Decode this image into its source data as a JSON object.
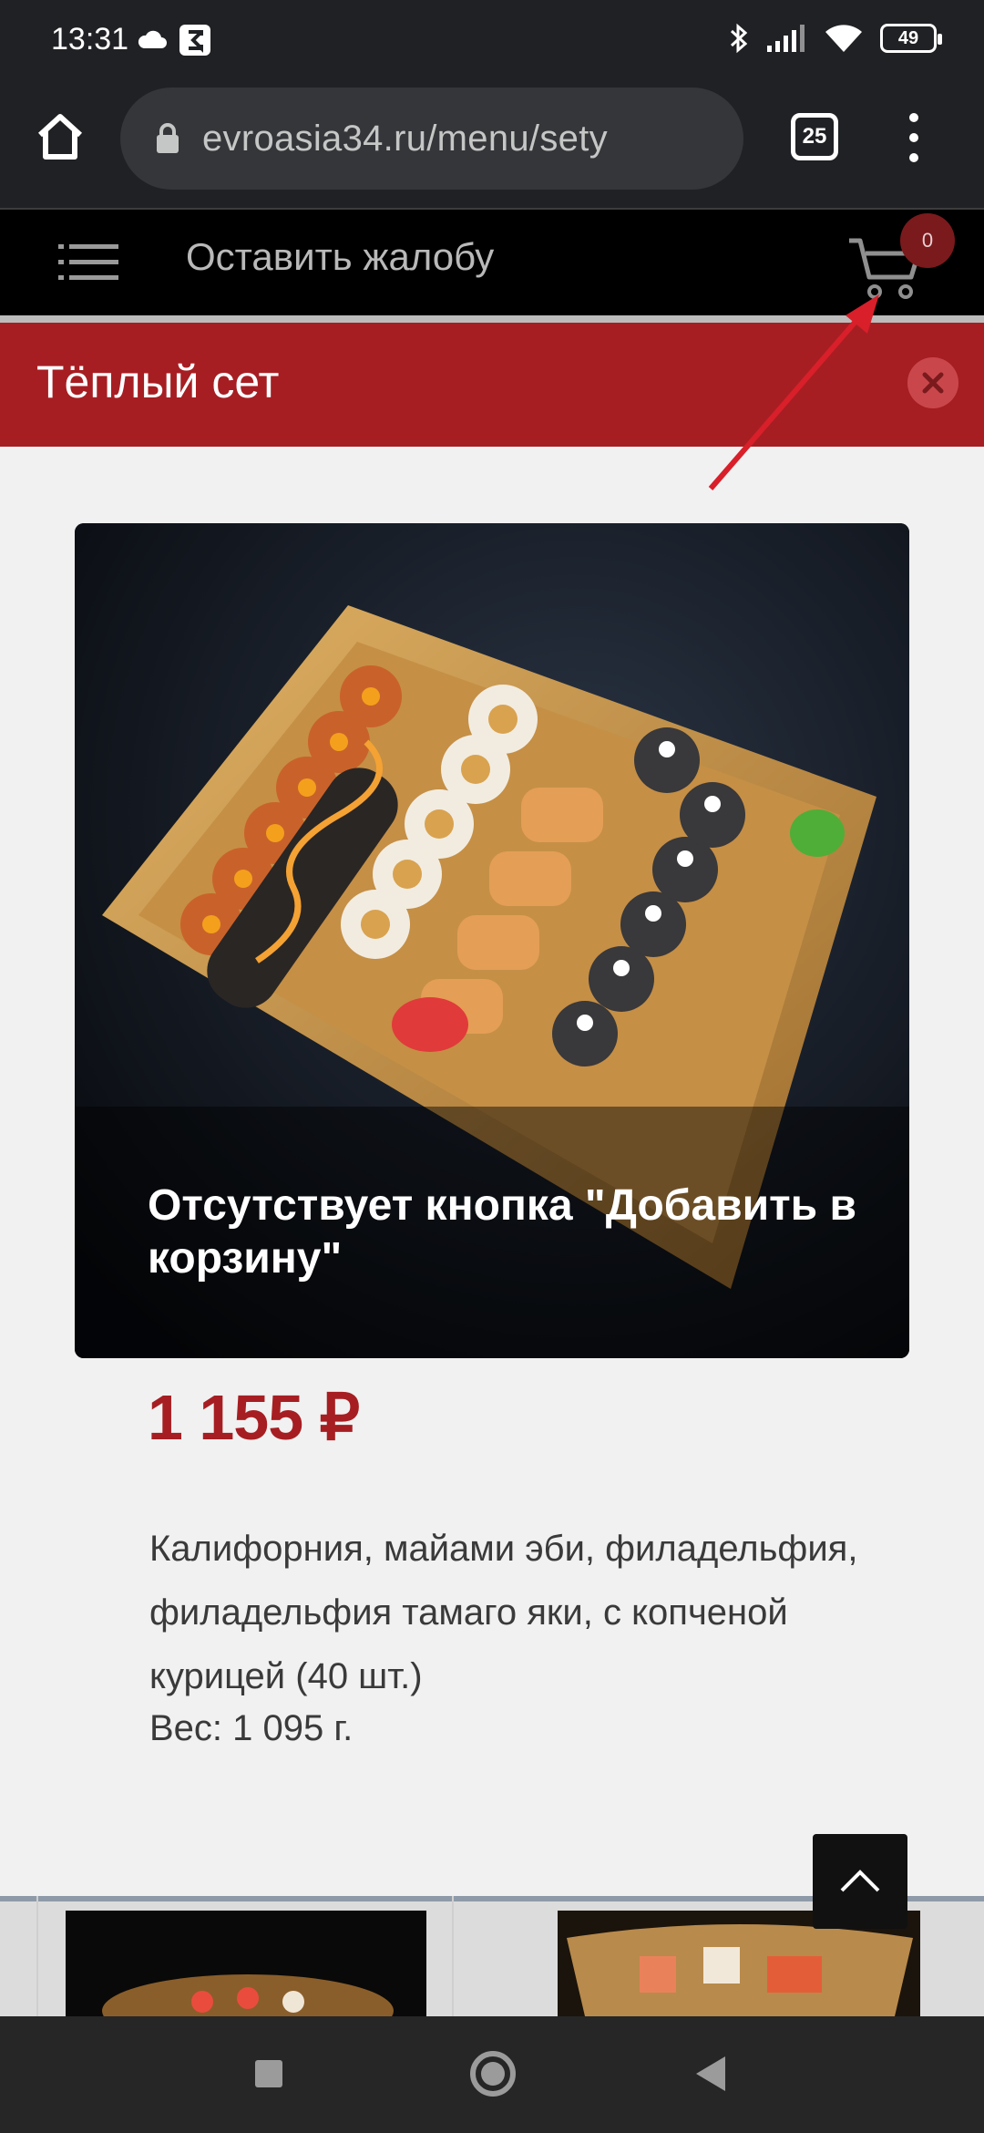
{
  "status_bar": {
    "time": "13:31",
    "battery": "49",
    "icons": [
      "cloud-icon",
      "sigma-app-icon",
      "bluetooth-icon",
      "signal-icon",
      "wifi-icon",
      "battery-icon"
    ]
  },
  "browser": {
    "url": "evroasia34.ru/menu/sety",
    "tab_count": "25"
  },
  "site_header": {
    "complaint_link": "Оставить жалобу",
    "cart_count": "0"
  },
  "modal": {
    "title": "Тёплый сет",
    "image_caption": "Отсутствует кнопка \"Добавить в корзину\"",
    "price": "1 155 ₽",
    "description": "Калифорния, майами эби, филадельфия, филадельфия тамаго яки, с копченой курицей (40 шт.)",
    "weight": "Вес: 1 095 г."
  },
  "colors": {
    "brand_red": "#a61e22",
    "annotation_red": "#d81f2a",
    "header_black": "#000000"
  }
}
